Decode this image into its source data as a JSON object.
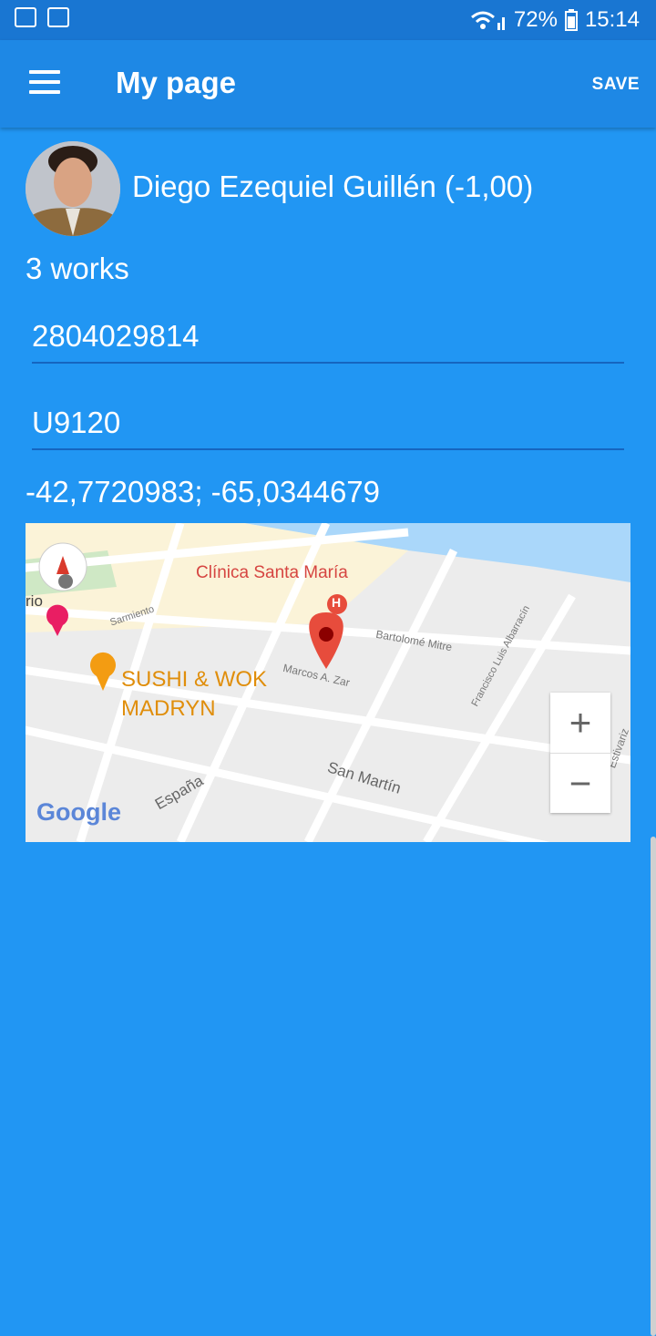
{
  "status_bar": {
    "battery": "72%",
    "time": "15:14"
  },
  "app_bar": {
    "title": "My page",
    "save_label": "SAVE"
  },
  "profile": {
    "name": "Diego Ezequiel Guillén (-1,00)",
    "works": "3 works",
    "phone": "2804029814",
    "postal_code": "U9120",
    "coordinates": "-42,7720983; -65,0344679"
  },
  "map": {
    "labels": {
      "clinic": "Clínica Santa María",
      "hospital_letter": "H",
      "restaurant_line1": "SUSHI & WOK",
      "restaurant_line2": "MADRYN",
      "rio": "rio",
      "sarmiento": "Sarmiento",
      "bartolome": "Bartolomé Mitre",
      "marcos": "Marcos A. Zar",
      "francisco": "Francisco Luis Albarracín",
      "san_martin": "San Martín",
      "espana": "España",
      "estivariz": "Estivariz",
      "google": "Google"
    },
    "zoom_in": "+",
    "zoom_out": "−"
  }
}
